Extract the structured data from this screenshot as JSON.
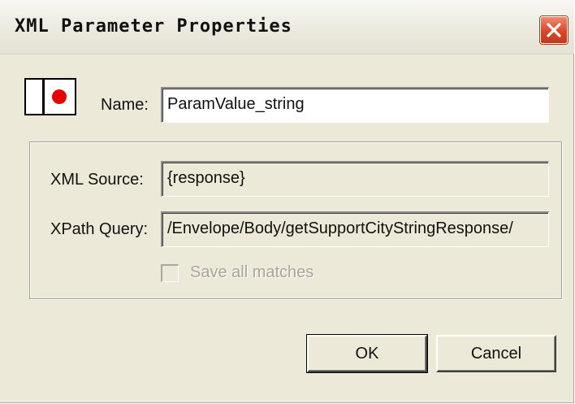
{
  "dialog": {
    "title": "XML Parameter Properties",
    "close_icon": "close-icon",
    "app_icon": "parameter-icon"
  },
  "form": {
    "name_label": "Name:",
    "name_value": "ParamValue_string",
    "xml_source_label": "XML Source:",
    "xml_source_value": "{response}",
    "xpath_label": "XPath Query:",
    "xpath_value": "/Envelope/Body/getSupportCityStringResponse/",
    "save_all_label": "Save all matches",
    "save_all_checked": false
  },
  "buttons": {
    "ok": "OK",
    "cancel": "Cancel"
  },
  "colors": {
    "dialog_bg": "#ece9d8",
    "close_button": "#d9472b",
    "icon_dot": "#e60000"
  }
}
